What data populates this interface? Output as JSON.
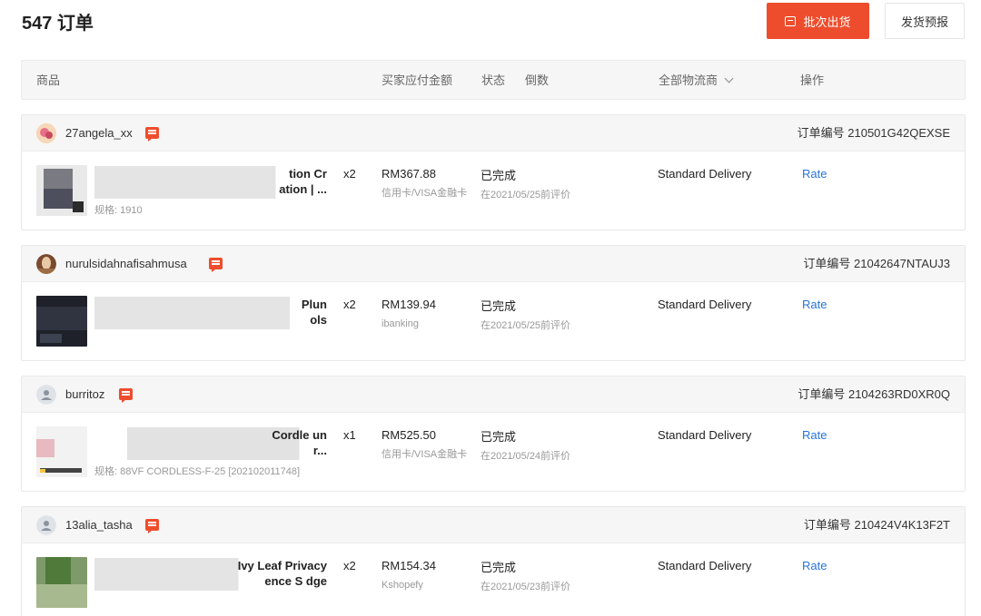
{
  "header": {
    "title": "547 订单",
    "batch_ship_label": "批次出货",
    "ship_notice_label": "发货预报"
  },
  "table_header": {
    "product": "商品",
    "amount": "买家应付金额",
    "status": "状态",
    "countdown": "倒数",
    "carrier": "全部物流商",
    "action": "操作"
  },
  "colors": {
    "accent": "#ee4d2d",
    "link": "#2673dd"
  },
  "orders": [
    {
      "buyer": "27angela_xx",
      "order_no": "订单编号 210501G42QEXSE",
      "product_name": "tion Cr\nation | ...",
      "variant": "规格: 1910",
      "qty": "x2",
      "amount": "RM367.88",
      "payment": "信用卡/VISA金融卡",
      "status": "已完成",
      "status_note": "在2021/05/25前评价",
      "delivery": "Standard Delivery",
      "action": "Rate"
    },
    {
      "buyer": "nurulsidahnafisahmusa",
      "order_no": "订单编号 21042647NTAUJ3",
      "product_name": "Plun\nols",
      "variant": "",
      "qty": "x2",
      "amount": "RM139.94",
      "payment": "ibanking",
      "status": "已完成",
      "status_note": "在2021/05/25前评价",
      "delivery": "Standard Delivery",
      "action": "Rate"
    },
    {
      "buyer": "burritoz",
      "order_no": "订单编号 2104263RD0XR0Q",
      "product_name": "Cordle                 un\nr...",
      "variant": "规格: 88VF CORDLESS-F-25 [202102011748]",
      "qty": "x1",
      "amount": "RM525.50",
      "payment": "信用卡/VISA金融卡",
      "status": "已完成",
      "status_note": "在2021/05/24前评价",
      "delivery": "Standard Delivery",
      "action": "Rate"
    },
    {
      "buyer": "13alia_tasha",
      "order_no": "订单编号 210424V4K13F2T",
      "product_name": "Ivy Leaf Privacy\nence S                dge",
      "variant": "",
      "qty": "x2",
      "amount": "RM154.34",
      "payment": "Kshopefy",
      "status": "已完成",
      "status_note": "在2021/05/23前评价",
      "delivery": "Standard Delivery",
      "action": "Rate"
    }
  ]
}
